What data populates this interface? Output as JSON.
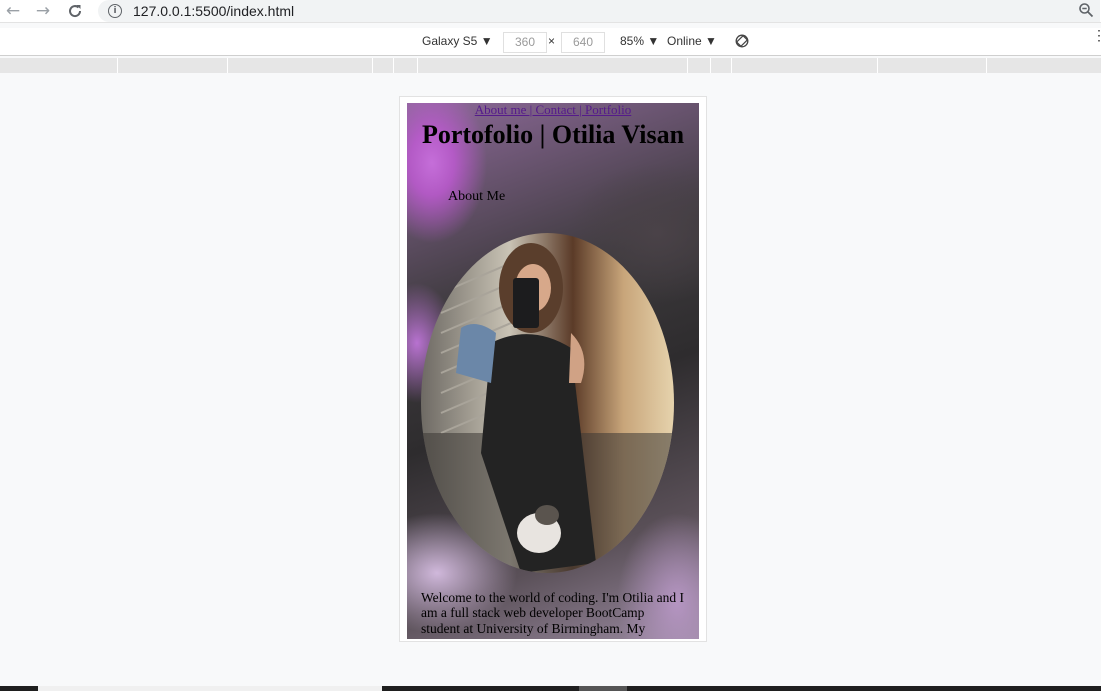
{
  "browser": {
    "url": "127.0.0.1:5500/index.html",
    "back_icon": "arrow-left-icon",
    "forward_icon": "arrow-right-icon",
    "reload_icon": "reload-icon",
    "info_icon": "info-icon",
    "zoom_icon": "zoom-out-icon"
  },
  "device_toolbar": {
    "device": "Galaxy S5 ▼",
    "width": "360",
    "separator": "×",
    "height": "640",
    "zoom": "85% ▼",
    "throttle": "Online ▼",
    "rotate_icon": "rotate-icon",
    "more_icon": "more-vertical-icon"
  },
  "page": {
    "top_link": "About me | Contact | Portfolio",
    "title": "Portofolio | Otilia Visan",
    "about_link": "About Me",
    "intro": "Welcome to the world of coding. I'm Otilia and I am a full stack web developer BootCamp student at University of Birmingham. My"
  },
  "colors": {
    "link": "#551a8b",
    "background": "#f8f9fa"
  }
}
